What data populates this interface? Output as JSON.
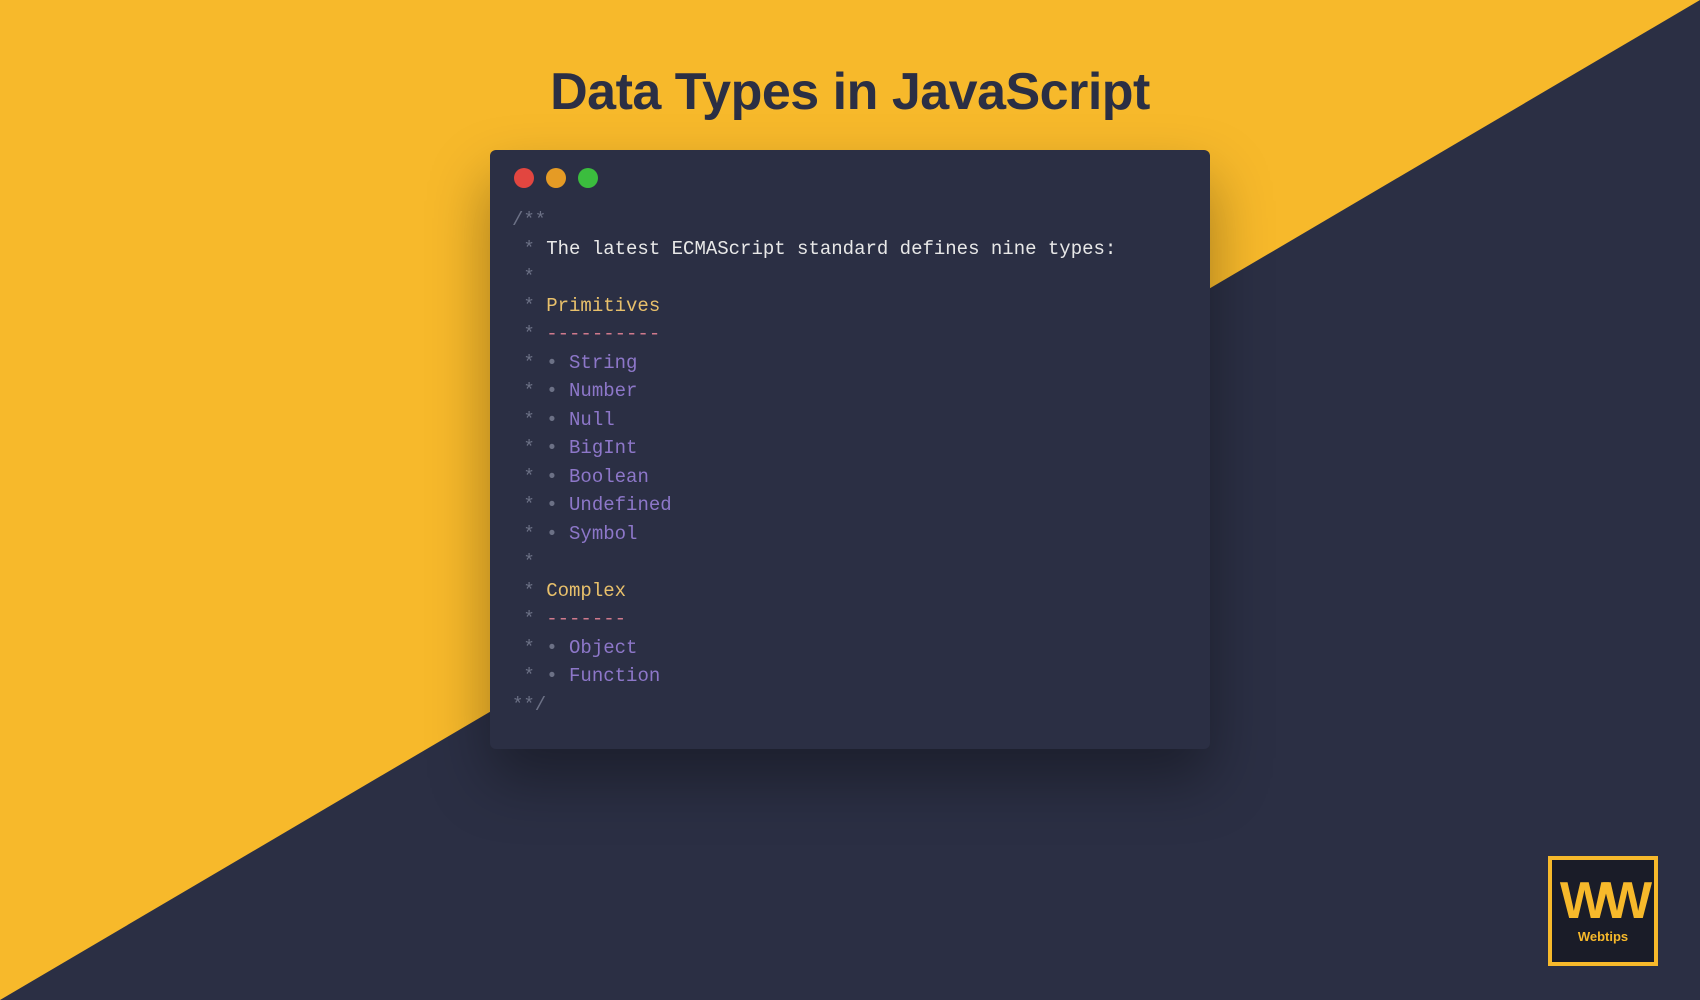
{
  "title": "Data Types in JavaScript",
  "code": {
    "open": "/**",
    "intro": "The latest ECMAScript standard defines nine types:",
    "section1": "Primitives",
    "divider1": "----------",
    "primitives": [
      "String",
      "Number",
      "Null",
      "BigInt",
      "Boolean",
      "Undefined",
      "Symbol"
    ],
    "section2": "Complex",
    "divider2": "-------",
    "complex": [
      "Object",
      "Function"
    ],
    "star": " * ",
    "star_empty": " *",
    "bullet": "• ",
    "close": "**/"
  },
  "logo": {
    "mark": "WW",
    "text": "Webtips"
  }
}
